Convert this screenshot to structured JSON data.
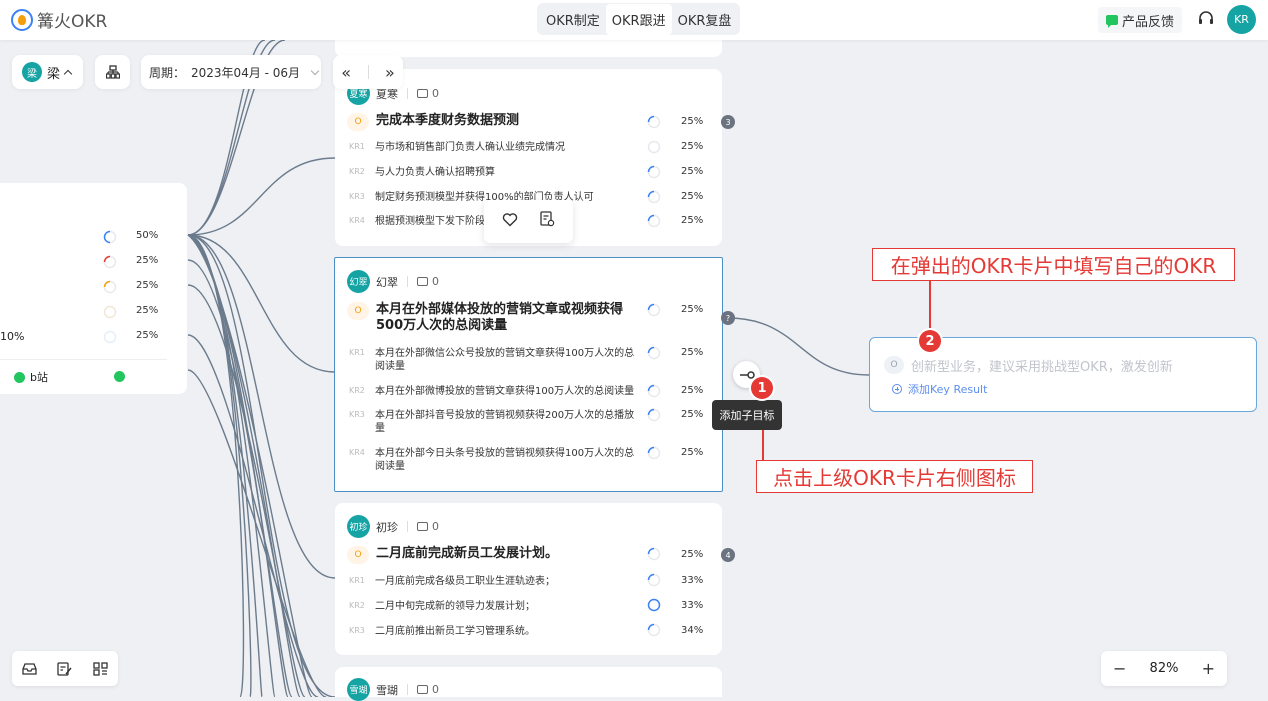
{
  "app": {
    "name": "篝火OKR"
  },
  "mode_tabs": [
    {
      "label": "OKR制定",
      "active": false
    },
    {
      "label": "OKR跟进",
      "active": true
    },
    {
      "label": "OKR复盘",
      "active": false
    }
  ],
  "header": {
    "feedback_label": "产品反馈",
    "user_avatar": "KR"
  },
  "controls": {
    "user_avatar": "梁",
    "user_name": "梁",
    "period_label": "周期：",
    "period_value": "2023年04月 - 06月"
  },
  "left_card": {
    "rows": [
      {
        "prefix": "",
        "percent": "50%"
      },
      {
        "prefix": "",
        "percent": "25%"
      },
      {
        "prefix": "",
        "percent": "25%"
      },
      {
        "prefix": "",
        "percent": "25%"
      },
      {
        "prefix": "10%",
        "percent": "25%"
      }
    ],
    "tag": "b站"
  },
  "cards": [
    {
      "owner": "夏寒",
      "owner_avatar": "夏寒",
      "comments": "0",
      "child_count": "3",
      "objective": {
        "badge": "O",
        "text": "完成本季度财务数据预测",
        "percent": "25%"
      },
      "krs": [
        {
          "label": "KR1",
          "text": "与市场和销售部门负责人确认业绩完成情况",
          "percent": "25%"
        },
        {
          "label": "KR2",
          "text": "与人力负责人确认招聘预算",
          "percent": "25%"
        },
        {
          "label": "KR3",
          "text": "制定财务预测模型并获得100%的部门负责人认可",
          "percent": "25%"
        },
        {
          "label": "KR4",
          "text": "根据预测模型下发下阶段",
          "percent": "25%"
        }
      ]
    },
    {
      "owner": "幻翠",
      "owner_avatar": "幻翠",
      "comments": "0",
      "child_count": "?",
      "objective": {
        "badge": "O",
        "text": "本月在外部媒体投放的营销文章或视频获得500万人次的总阅读量",
        "percent": "25%"
      },
      "krs": [
        {
          "label": "KR1",
          "text": "本月在外部微信公众号投放的营销文章获得100万人次的总阅读量",
          "percent": "25%"
        },
        {
          "label": "KR2",
          "text": "本月在外部微博投放的营销文章获得100万人次的总阅读量",
          "percent": "25%"
        },
        {
          "label": "KR3",
          "text": "本月在外部抖音号投放的营销视频获得200万人次的总播放量",
          "percent": "25%"
        },
        {
          "label": "KR4",
          "text": "本月在外部今日头条号投放的营销视频获得100万人次的总阅读量",
          "percent": "25%"
        }
      ]
    },
    {
      "owner": "初珍",
      "owner_avatar": "初珍",
      "comments": "0",
      "child_count": "4",
      "objective": {
        "badge": "O",
        "text": "二月底前完成新员工发展计划。",
        "percent": "25%"
      },
      "krs": [
        {
          "label": "KR1",
          "text": "一月底前完成各级员工职业生涯轨迹表；",
          "percent": "33%"
        },
        {
          "label": "KR2",
          "text": "二月中旬完成新的领导力发展计划；",
          "percent": "33%"
        },
        {
          "label": "KR3",
          "text": "二月底前推出新员工学习管理系统。",
          "percent": "34%"
        }
      ]
    },
    {
      "owner": "雪瑚",
      "owner_avatar": "雪瑚",
      "comments": "0"
    }
  ],
  "tooltip": "添加子目标",
  "markers": [
    "1",
    "2"
  ],
  "annotations": {
    "step1": "点击上级OKR卡片右侧图标",
    "step2": "在弹出的OKR卡片中填写自己的OKR"
  },
  "new_card": {
    "badge": "O",
    "placeholder": "创新型业务，建议采用挑战型OKR，激发创新",
    "add_kr": "添加Key Result"
  },
  "zoom": {
    "minus": "−",
    "value": "82%",
    "plus": "+"
  },
  "colors": {
    "accent": "#16a3a4",
    "annotation": "#e53935",
    "link": "#5b8def"
  }
}
